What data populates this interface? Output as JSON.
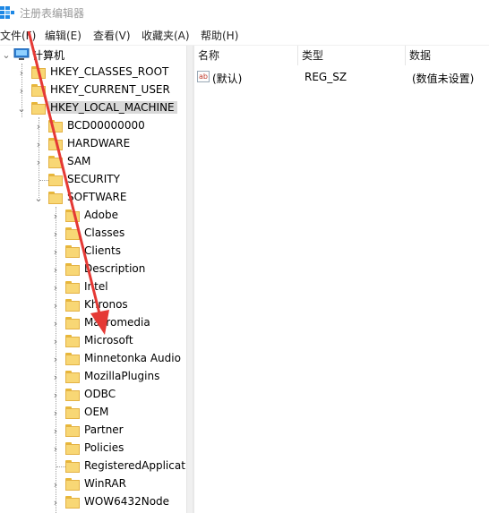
{
  "window": {
    "title": "注册表编辑器"
  },
  "menu": [
    "文件(F)",
    "编辑(E)",
    "查看(V)",
    "收藏夹(A)",
    "帮助(H)"
  ],
  "tree": {
    "root": "计算机",
    "hives": [
      "HKEY_CLASSES_ROOT",
      "HKEY_CURRENT_USER",
      "HKEY_LOCAL_MACHINE"
    ],
    "hklm_children": [
      "BCD00000000",
      "HARDWARE",
      "SAM",
      "SECURITY",
      "SOFTWARE"
    ],
    "software_children": [
      "Adobe",
      "Classes",
      "Clients",
      "Description",
      "Intel",
      "Khronos",
      "Macromedia",
      "Microsoft",
      "Minnetonka Audio",
      "MozillaPlugins",
      "ODBC",
      "OEM",
      "Partner",
      "Policies",
      "RegisteredApplicati",
      "WinRAR",
      "WOW6432Node"
    ]
  },
  "list": {
    "columns": [
      "名称",
      "类型",
      "数据"
    ],
    "rows": [
      {
        "name": "(默认)",
        "type": "REG_SZ",
        "data": "(数值未设置)"
      }
    ]
  },
  "colors": {
    "arrow": "#e53935",
    "folder": "#f8d775",
    "selected": "#d9d9d9"
  }
}
